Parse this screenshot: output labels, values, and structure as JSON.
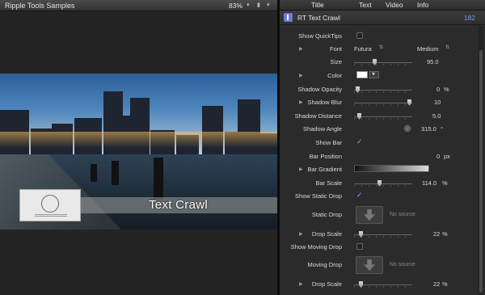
{
  "viewer": {
    "title": "Ripple Tools Samples",
    "zoom": "83%",
    "canvas": {
      "overlay_text": "Text Crawl"
    }
  },
  "inspector": {
    "tabs": [
      "Title",
      "Text",
      "Video",
      "Info"
    ],
    "header": {
      "title": "RT Text Crawl",
      "value": "182"
    },
    "params": {
      "show_quicktips": {
        "label": "Show QuickTips",
        "checked": false
      },
      "font": {
        "label": "Font",
        "family": "Futura",
        "weight": "Medium"
      },
      "size": {
        "label": "Size",
        "value": "95.0"
      },
      "color": {
        "label": "Color",
        "value": "#ffffff"
      },
      "shadow_opacity": {
        "label": "Shadow Opacity",
        "value": "0",
        "unit": "%"
      },
      "shadow_blur": {
        "label": "Shadow Blur",
        "value": "10"
      },
      "shadow_distance": {
        "label": "Shadow Distance",
        "value": "5.0"
      },
      "shadow_angle": {
        "label": "Shadow Angle",
        "value": "315.0",
        "unit": "°"
      },
      "show_bar": {
        "label": "Show Bar",
        "checked": true
      },
      "bar_position": {
        "label": "Bar Position",
        "value": "0",
        "unit": "px"
      },
      "bar_gradient": {
        "label": "Bar Gradient"
      },
      "bar_scale": {
        "label": "Bar Scale",
        "value": "114.0",
        "unit": "%"
      },
      "show_static_drop": {
        "label": "Show Static Drop",
        "checked": true
      },
      "static_drop": {
        "label": "Static Drop",
        "placeholder": "No source"
      },
      "drop_scale_1": {
        "label": "Drop Scale",
        "value": "22",
        "unit": "%"
      },
      "show_moving_drop": {
        "label": "Show Moving Drop",
        "checked": false
      },
      "moving_drop": {
        "label": "Moving Drop",
        "placeholder": "No source"
      },
      "drop_scale_2": {
        "label": "Drop Scale",
        "value": "22",
        "unit": "%"
      }
    }
  }
}
